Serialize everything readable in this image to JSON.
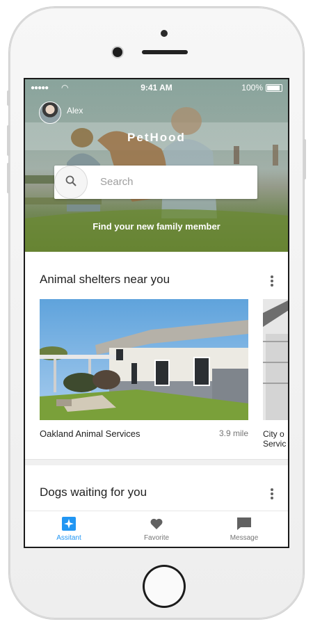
{
  "status_bar": {
    "time": "9:41 AM",
    "battery": "100%",
    "signal": "●●●●●",
    "wifi": "◠"
  },
  "user": {
    "name": "Alex"
  },
  "app": {
    "brand": "PetHood",
    "tagline": "Find your new family member"
  },
  "search": {
    "placeholder": "Search",
    "icon": "search-icon"
  },
  "sections": [
    {
      "title": "Animal shelters near you",
      "cards": [
        {
          "name": "Oakland Animal Services",
          "distance": "3.9 mile"
        },
        {
          "name": "City of Oakland Services",
          "name_line1": "City o",
          "name_line2": "Servic"
        }
      ]
    },
    {
      "title": "Dogs waiting for you"
    }
  ],
  "nav": {
    "items": [
      {
        "label": "Assitant",
        "icon": "assistant-icon",
        "active": true
      },
      {
        "label": "Favorite",
        "icon": "heart-icon",
        "active": false
      },
      {
        "label": "Message",
        "icon": "message-icon",
        "active": false
      }
    ]
  },
  "colors": {
    "accent": "#2196F3",
    "inactive": "#757575",
    "icon_inactive": "#616161"
  }
}
